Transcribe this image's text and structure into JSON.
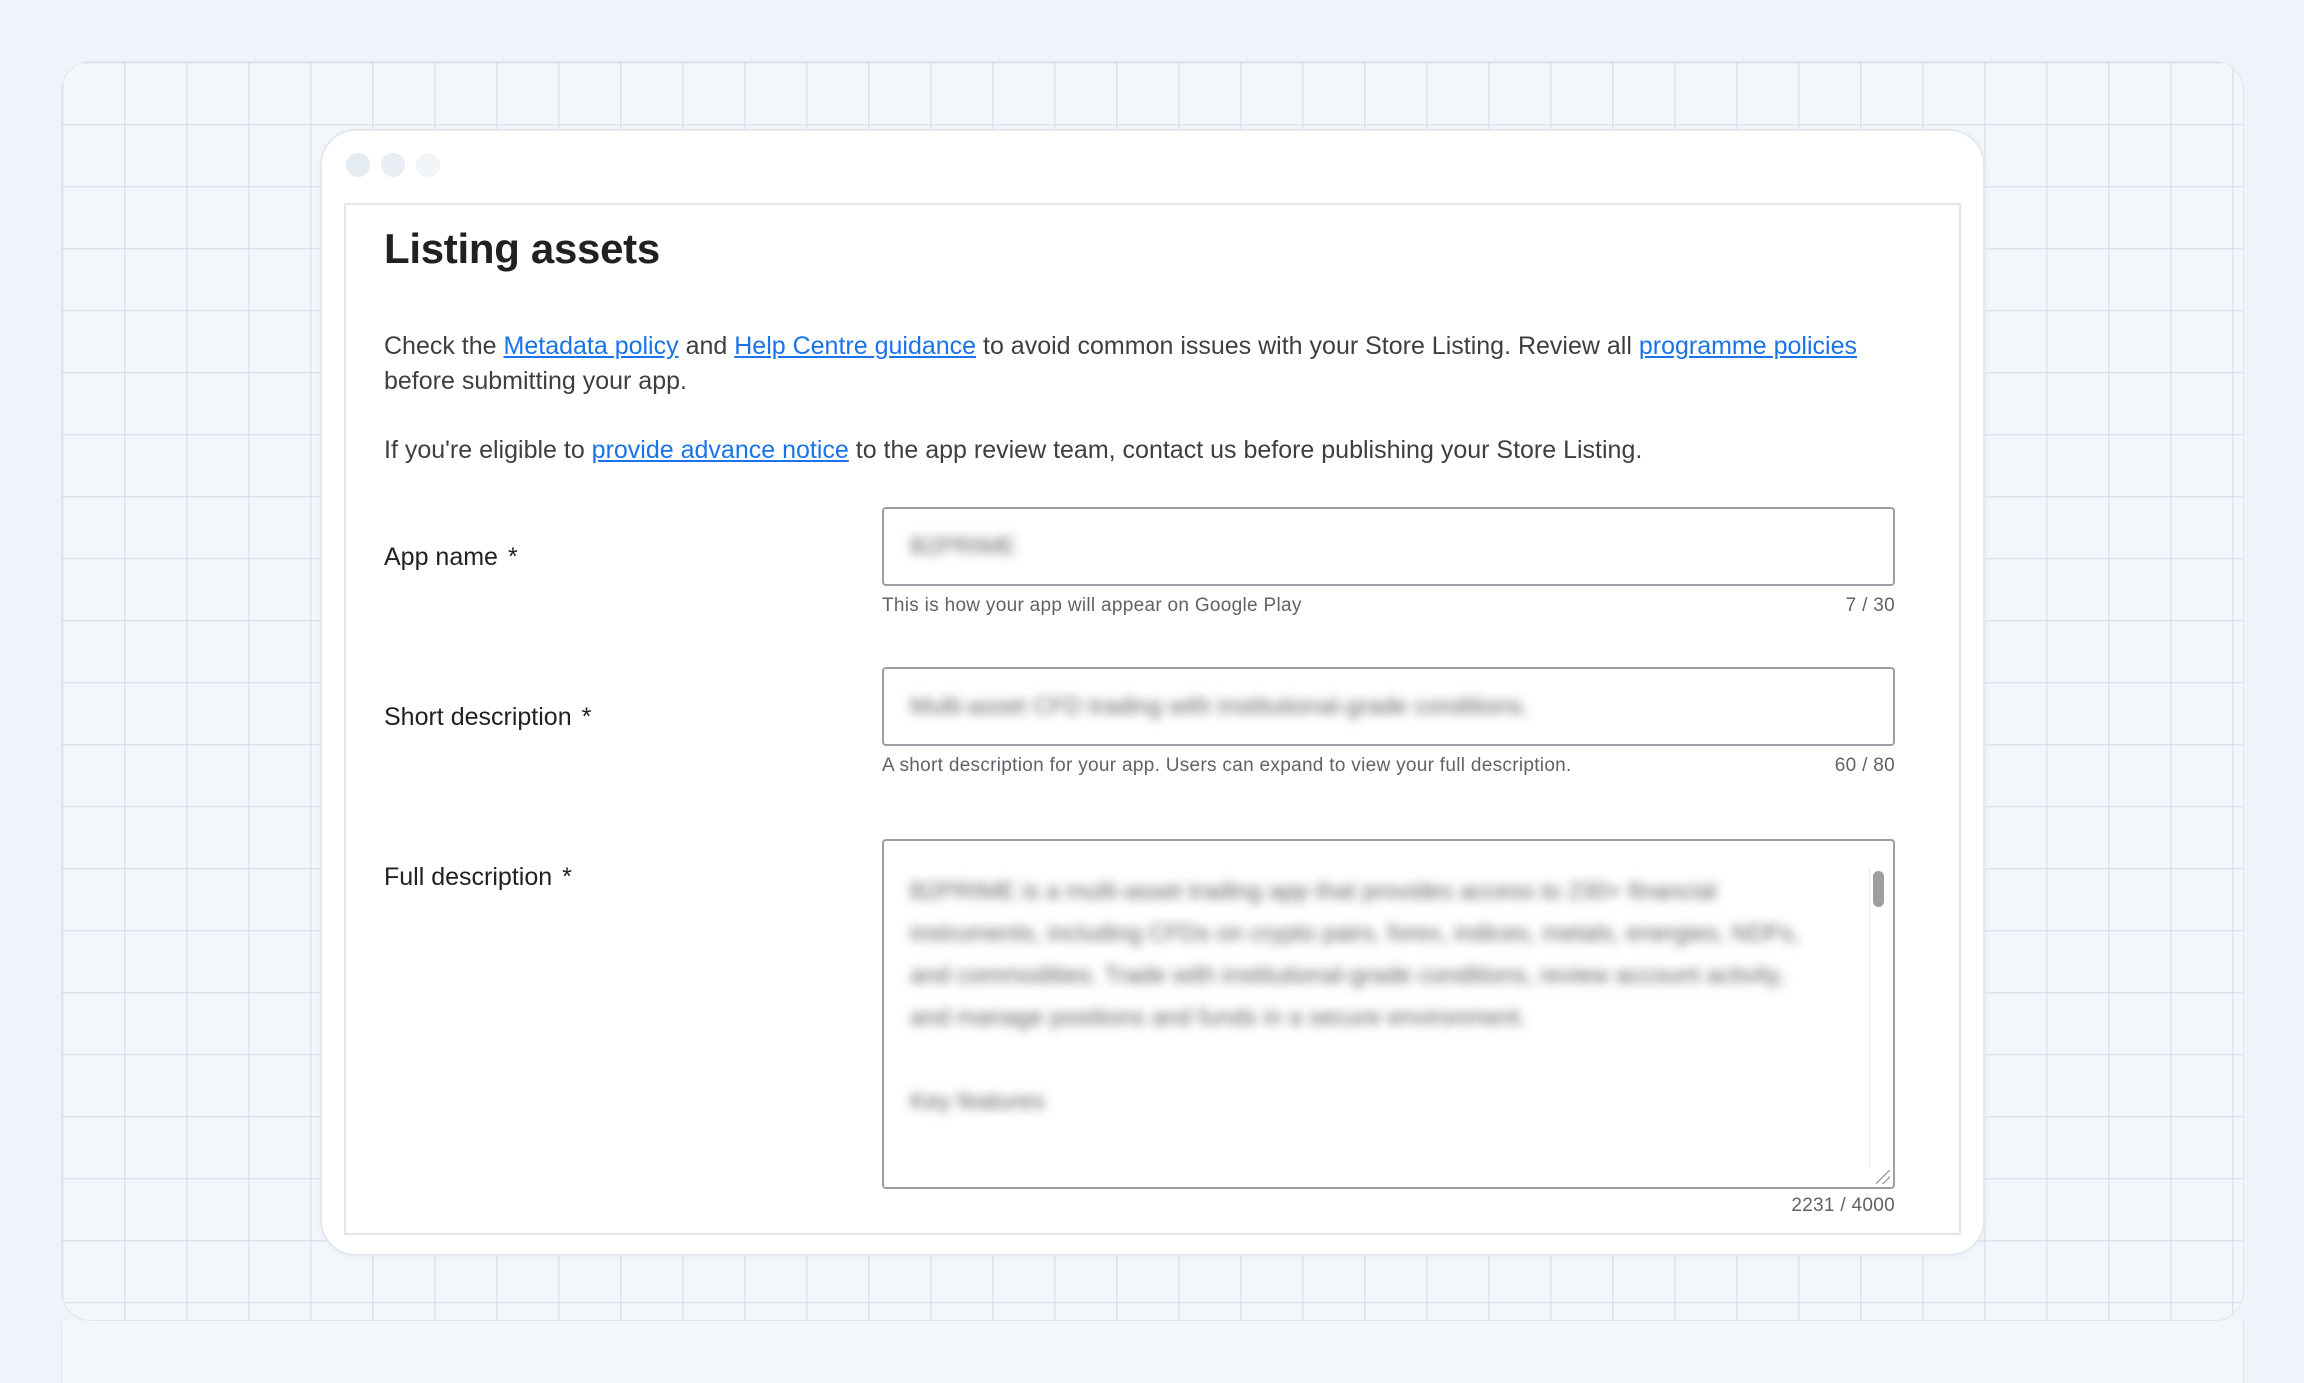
{
  "page": {
    "title": "Listing assets",
    "intro": {
      "text_1": "Check the ",
      "link_metadata": "Metadata policy",
      "text_2": " and ",
      "link_help": "Help Centre guidance",
      "text_3": " to avoid common issues with your Store Listing. Review all ",
      "link_programme": "programme policies",
      "text_4": " before submitting your app."
    },
    "notice": {
      "text_1": "If you're eligible to ",
      "link_notice": "provide advance notice",
      "text_2": " to the app review team, contact us before publishing your Store Listing."
    }
  },
  "form": {
    "required_marker": "*",
    "app_name": {
      "label": "App name",
      "value": "B2PRIME",
      "helper": "This is how your app will appear on Google Play",
      "counter": "7 / 30"
    },
    "short_description": {
      "label": "Short description",
      "value": "Multi-asset CFD trading with institutional-grade conditions.",
      "helper": "A short description for your app. Users can expand to view your full description.",
      "counter": "60 / 80"
    },
    "full_description": {
      "label": "Full description",
      "value": "B2PRIME is a multi-asset trading app that provides access to 230+ financial instruments, including CFDs on crypto pairs, forex, indices, metals, energies, NDFs, and commodities. Trade with institutional-grade conditions, review account activity, and manage positions and funds in a secure environment.\n\nKey features",
      "counter": "2231 / 4000"
    }
  },
  "colors": {
    "link": "#1a73e8",
    "border": "#9aa0a6",
    "helper_text": "#5f6368"
  }
}
